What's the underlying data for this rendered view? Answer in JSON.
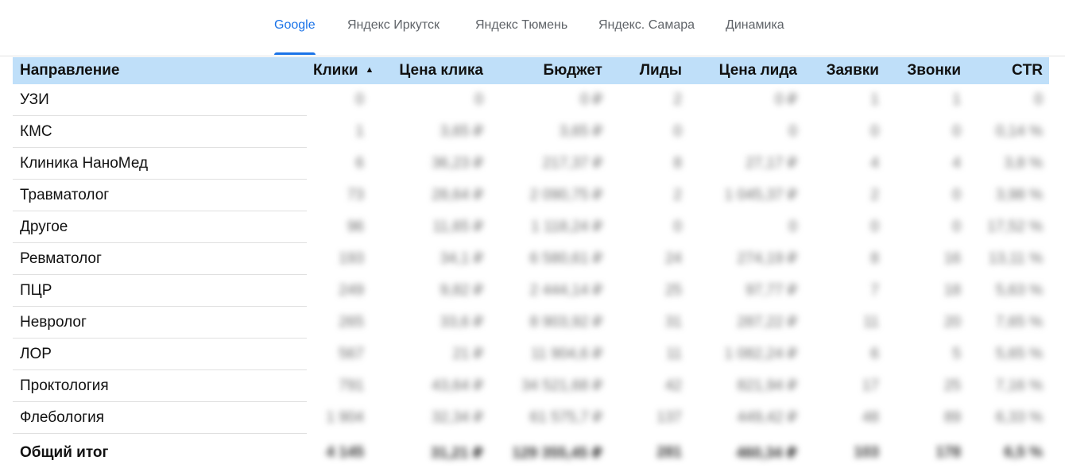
{
  "tabs": [
    {
      "label": "Google",
      "active": true
    },
    {
      "label": "Яндекс Иркутск",
      "active": false
    },
    {
      "label": "Яндекс Тюмень",
      "active": false
    },
    {
      "label": "Яндекс. Самара",
      "active": false
    },
    {
      "label": "Динамика",
      "active": false
    }
  ],
  "colors": {
    "accent": "#1a73e8",
    "header_bg": "#bfdff9"
  },
  "table": {
    "columns": [
      "Направление",
      "Клики",
      "Цена клика",
      "Бюджет",
      "Лиды",
      "Цена лида",
      "Заявки",
      "Звонки",
      "CTR"
    ],
    "sort_indicator": "▲",
    "rows": [
      {
        "name": "УЗИ",
        "cells": [
          "0",
          "0",
          "0 ₽",
          "2",
          "0 ₽",
          "1",
          "1",
          "0"
        ]
      },
      {
        "name": "КМС",
        "cells": [
          "1",
          "3,65 ₽",
          "3,65 ₽",
          "0",
          "0",
          "0",
          "0",
          "0,14 %"
        ]
      },
      {
        "name": "Клиника НаноМед",
        "cells": [
          "6",
          "36,23 ₽",
          "217,37 ₽",
          "8",
          "27,17 ₽",
          "4",
          "4",
          "3,8 %"
        ]
      },
      {
        "name": "Травматолог",
        "cells": [
          "73",
          "28,64 ₽",
          "2 090,75 ₽",
          "2",
          "1 045,37 ₽",
          "2",
          "0",
          "3,98 %"
        ]
      },
      {
        "name": "Другое",
        "cells": [
          "96",
          "11,65 ₽",
          "1 118,24 ₽",
          "0",
          "0",
          "0",
          "0",
          "17,52 %"
        ]
      },
      {
        "name": "Ревматолог",
        "cells": [
          "193",
          "34,1 ₽",
          "6 580,61 ₽",
          "24",
          "274,19 ₽",
          "8",
          "16",
          "13,11 %"
        ]
      },
      {
        "name": "ПЦР",
        "cells": [
          "249",
          "9,82 ₽",
          "2 444,14 ₽",
          "25",
          "97,77 ₽",
          "7",
          "18",
          "5,63 %"
        ]
      },
      {
        "name": "Невролог",
        "cells": [
          "265",
          "33,6 ₽",
          "8 903,92 ₽",
          "31",
          "287,22 ₽",
          "11",
          "20",
          "7,65 %"
        ]
      },
      {
        "name": "ЛОР",
        "cells": [
          "567",
          "21 ₽",
          "11 904,6 ₽",
          "11",
          "1 082,24 ₽",
          "6",
          "5",
          "5,65 %"
        ]
      },
      {
        "name": "Проктология",
        "cells": [
          "791",
          "43,64 ₽",
          "34 521,68 ₽",
          "42",
          "821,94 ₽",
          "17",
          "25",
          "7,16 %"
        ]
      },
      {
        "name": "Флебология",
        "cells": [
          "1 904",
          "32,34 ₽",
          "61 575,7 ₽",
          "137",
          "449,42 ₽",
          "48",
          "89",
          "6,33 %"
        ]
      }
    ],
    "total": {
      "name": "Общий итог",
      "cells": [
        "4 145",
        "31,21 ₽",
        "129 355,45 ₽",
        "281",
        "460,34 ₽",
        "103",
        "178",
        "6,5 %"
      ]
    }
  }
}
